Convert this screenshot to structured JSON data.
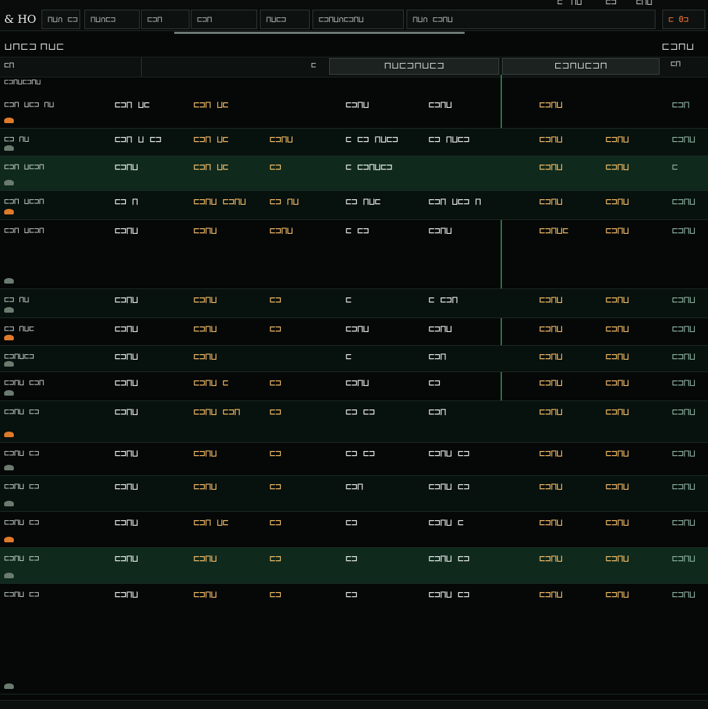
{
  "app": {
    "logo": "& HO",
    "tabs": [
      "⊓⊔∩ ⊏⊐",
      "⊓⊔∩⊏⊐",
      "⊏⊐⊓",
      "⊏⊐⊓",
      "⊓⊔⊏⊐",
      "⊏⊐⊓⊔∩⊏⊐⊓⊔",
      "⊓⊔∩ ⊏⊐⊓⊔"
    ],
    "top_right": [
      "⊏",
      "⊓⊔",
      "⊏⊐",
      "⊏⊓⊔"
    ],
    "corner_value": "⊏ 0⊐"
  },
  "titles": {
    "left": "⊔⊓⊏⊐ ⊓⊔⊏",
    "right": "⊏⊐⊓⊔"
  },
  "subbar": {
    "left": "⊏⊓",
    "mid_marker": "⊏",
    "col_head_1": "⊓⊔⊏⊐⊓⊔⊏⊐",
    "col_head_2": "⊏⊐⊓⊔⊏⊐⊓",
    "right": "⊏⊓"
  },
  "section_label": "⊏⊐⊓⊔⊏⊐⊓⊔",
  "colors": {
    "accent_green": "#2e7a44",
    "amber": "#ffc36b",
    "bg": "#050807"
  },
  "rows": [
    {
      "a": "⊏⊐⊓ ⊔⊏⊐ ⊓⊔",
      "b": "⊏⊐⊓ ⊔⊏",
      "c": "⊏⊐⊓ ⊔⊏",
      "d": "",
      "e": "⊏⊐⊓⊔",
      "f": "⊏⊐⊓⊔",
      "g": "⊏⊐⊓⊔",
      "h": "",
      "i": "⊏⊐⊓"
    },
    {
      "a": "⊏⊐ ⊓⊔",
      "b": "⊏⊐⊓ ⊔ ⊏⊐",
      "c": "⊏⊐⊓ ⊔⊏",
      "d": "⊏⊐⊓⊔",
      "e": "⊏ ⊏⊐ ⊓⊔⊏⊐",
      "f": "⊏⊐ ⊓⊔⊏⊐",
      "g": "⊏⊐⊓⊔",
      "h": "⊏⊐⊓⊔",
      "i": "⊏⊐⊓⊔"
    },
    {
      "a": "⊏⊐⊓ ⊔⊏⊐⊓",
      "b": "⊏⊐⊓⊔",
      "c": "⊏⊐⊓ ⊔⊏",
      "d": "⊏⊐",
      "e": "⊏ ⊏⊐⊓⊔⊏⊐",
      "f": "",
      "g": "⊏⊐⊓⊔",
      "h": "⊏⊐⊓⊔",
      "i": "⊏"
    },
    {
      "a": "⊏⊐⊓ ⊔⊏⊐⊓",
      "b": "⊏⊐ ⊓",
      "c": "⊏⊐⊓⊔ ⊏⊐⊓⊔",
      "d": "⊏⊐ ⊓⊔",
      "e": "⊏⊐ ⊓⊔⊏",
      "f": "⊏⊐⊓ ⊔⊏⊐ ⊓",
      "g": "⊏⊐⊓⊔",
      "h": "⊏⊐⊓⊔",
      "i": "⊏⊐⊓⊔"
    },
    {
      "a": "⊏⊐⊓ ⊔⊏⊐⊓",
      "b": "⊏⊐⊓⊔",
      "c": "⊏⊐⊓⊔",
      "d": "⊏⊐⊓⊔",
      "e": "⊏ ⊏⊐",
      "f": "⊏⊐⊓⊔",
      "g": "⊏⊐⊓⊔⊏",
      "h": "⊏⊐⊓⊔",
      "i": "⊏⊐⊓⊔"
    },
    {
      "a": "⊏⊐ ⊓⊔",
      "b": "⊏⊐⊓⊔",
      "c": "⊏⊐⊓⊔",
      "d": "⊏⊐",
      "e": "⊏",
      "f": "⊏ ⊏⊐⊓",
      "g": "⊏⊐⊓⊔",
      "h": "⊏⊐⊓⊔",
      "i": "⊏⊐⊓⊔"
    },
    {
      "a": "⊏⊐ ⊓⊔⊏",
      "b": "⊏⊐⊓⊔",
      "c": "⊏⊐⊓⊔",
      "d": "⊏⊐",
      "e": "⊏⊐⊓⊔",
      "f": "⊏⊐⊓⊔",
      "g": "⊏⊐⊓⊔",
      "h": "⊏⊐⊓⊔",
      "i": "⊏⊐⊓⊔"
    },
    {
      "a": "⊏⊐⊓⊔⊏⊐",
      "b": "⊏⊐⊓⊔",
      "c": "⊏⊐⊓⊔",
      "d": "",
      "e": "⊏",
      "f": "⊏⊐⊓",
      "g": "⊏⊐⊓⊔",
      "h": "⊏⊐⊓⊔",
      "i": "⊏⊐⊓⊔"
    },
    {
      "a": "⊏⊐⊓⊔ ⊏⊐⊓",
      "b": "⊏⊐⊓⊔",
      "c": "⊏⊐⊓⊔ ⊏",
      "d": "⊏⊐",
      "e": "⊏⊐⊓⊔",
      "f": "⊏⊐",
      "g": "⊏⊐⊓⊔",
      "h": "⊏⊐⊓⊔",
      "i": "⊏⊐⊓⊔"
    },
    {
      "a": "⊏⊐⊓⊔ ⊏⊐",
      "b": "⊏⊐⊓⊔",
      "c": "⊏⊐⊓⊔ ⊏⊐⊓",
      "d": "⊏⊐",
      "e": "⊏⊐ ⊏⊐",
      "f": "⊏⊐⊓",
      "g": "⊏⊐⊓⊔",
      "h": "⊏⊐⊓⊔",
      "i": "⊏⊐⊓⊔"
    },
    {
      "a": "⊏⊐⊓⊔ ⊏⊐",
      "b": "⊏⊐⊓⊔",
      "c": "⊏⊐⊓⊔",
      "d": "⊏⊐",
      "e": "⊏⊐ ⊏⊐",
      "f": "⊏⊐⊓⊔ ⊏⊐",
      "g": "⊏⊐⊓⊔",
      "h": "⊏⊐⊓⊔",
      "i": "⊏⊐⊓⊔"
    },
    {
      "a": "⊏⊐⊓⊔ ⊏⊐",
      "b": "⊏⊐⊓⊔",
      "c": "⊏⊐⊓⊔",
      "d": "⊏⊐",
      "e": "⊏⊐⊓",
      "f": "⊏⊐⊓⊔ ⊏⊐",
      "g": "⊏⊐⊓⊔",
      "h": "⊏⊐⊓⊔",
      "i": "⊏⊐⊓⊔"
    },
    {
      "a": "⊏⊐⊓⊔ ⊏⊐",
      "b": "⊏⊐⊓⊔",
      "c": "⊏⊐⊓ ⊔⊏",
      "d": "⊏⊐",
      "e": "⊏⊐",
      "f": "⊏⊐⊓⊔ ⊏",
      "g": "⊏⊐⊓⊔",
      "h": "⊏⊐⊓⊔",
      "i": "⊏⊐⊓⊔"
    },
    {
      "a": "⊏⊐⊓⊔ ⊏⊐",
      "b": "⊏⊐⊓⊔",
      "c": "⊏⊐⊓⊔",
      "d": "⊏⊐",
      "e": "⊏⊐",
      "f": "⊏⊐⊓⊔ ⊏⊐",
      "g": "⊏⊐⊓⊔",
      "h": "⊏⊐⊓⊔",
      "i": "⊏⊐⊓⊔"
    },
    {
      "a": "⊏⊐⊓⊔ ⊏⊐",
      "b": "⊏⊐⊓⊔",
      "c": "⊏⊐⊓⊔",
      "d": "⊏⊐",
      "e": "⊏⊐",
      "f": "⊏⊐⊓⊔ ⊏⊐",
      "g": "⊏⊐⊓⊔",
      "h": "⊏⊐⊓⊔",
      "i": "⊏⊐⊓⊔"
    }
  ]
}
